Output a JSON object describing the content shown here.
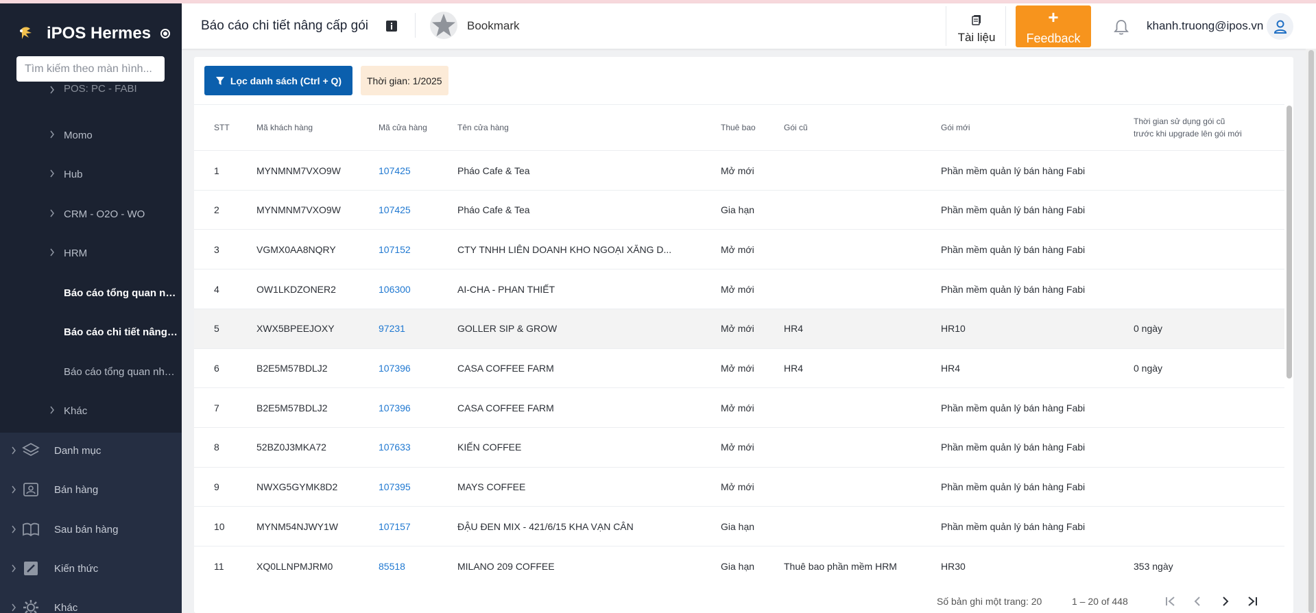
{
  "app": {
    "name": "iPOS Hermes"
  },
  "sidebar": {
    "search_placeholder": "Tìm kiếm theo màn hình...",
    "sub_items": [
      {
        "label": "POS: PC - FABI"
      },
      {
        "label": "Momo"
      },
      {
        "label": "Hub"
      },
      {
        "label": "CRM - O2O - WO"
      },
      {
        "label": "HRM"
      },
      {
        "label": "Báo cáo tổng quan nâng cấp gói"
      },
      {
        "label": "Báo cáo chi tiết nâng cấp gói"
      },
      {
        "label": "Báo cáo tổng quan nhân sự"
      },
      {
        "label": "Khác"
      }
    ],
    "main_items": [
      {
        "label": "Danh mục",
        "icon": "layers-icon"
      },
      {
        "label": "Bán hàng",
        "icon": "cashier-icon"
      },
      {
        "label": "Sau bán hàng",
        "icon": "book-icon"
      },
      {
        "label": "Kiến thức",
        "icon": "edit-box-icon"
      },
      {
        "label": "Khác",
        "icon": "gear-icon"
      }
    ]
  },
  "header": {
    "title": "Báo cáo chi tiết nâng cấp gói",
    "bookmark_label": "Bookmark",
    "docs_label": "Tài liệu",
    "feedback_plus": "+",
    "feedback_label": "Feedback",
    "user_email": "khanh.truong@ipos.vn"
  },
  "toolbar": {
    "filter_label": "Lọc danh sách (Ctrl + Q)",
    "time_label": "Thời gian: 1/2025"
  },
  "table": {
    "headers": {
      "stt": "STT",
      "customer_code": "Mã khách hàng",
      "store_code": "Mã cửa hàng",
      "store_name": "Tên cửa hàng",
      "subscription": "Thuê bao",
      "old_package": "Gói cũ",
      "new_package": "Gói mới",
      "usage_time_line1": "Thời gian sử dụng gói cũ",
      "usage_time_line2": "trước khi upgrade lên gói mới"
    },
    "rows": [
      {
        "stt": "1",
        "customer_code": "MYNMNM7VXO9W",
        "store_code": "107425",
        "store_name": "Pháo Cafe & Tea",
        "subscription": "Mở mới",
        "old_package": "",
        "new_package": "Phần mềm quản lý bán hàng Fabi",
        "usage_time": ""
      },
      {
        "stt": "2",
        "customer_code": "MYNMNM7VXO9W",
        "store_code": "107425",
        "store_name": "Pháo Cafe & Tea",
        "subscription": "Gia hạn",
        "old_package": "",
        "new_package": "Phần mềm quản lý bán hàng Fabi",
        "usage_time": ""
      },
      {
        "stt": "3",
        "customer_code": "VGMX0AA8NQRY",
        "store_code": "107152",
        "store_name": "CTY TNHH LIÊN DOANH KHO NGOẠI XĂNG D...",
        "subscription": "Mở mới",
        "old_package": "",
        "new_package": "Phần mềm quản lý bán hàng Fabi",
        "usage_time": ""
      },
      {
        "stt": "4",
        "customer_code": "OW1LKDZONER2",
        "store_code": "106300",
        "store_name": "AI-CHA - PHAN THIẾT",
        "subscription": "Mở mới",
        "old_package": "",
        "new_package": "Phần mềm quản lý bán hàng Fabi",
        "usage_time": ""
      },
      {
        "stt": "5",
        "customer_code": "XWX5BPEEJOXY",
        "store_code": "97231",
        "store_name": "GOLLER SIP & GROW",
        "subscription": "Mở mới",
        "old_package": "HR4",
        "new_package": "HR10",
        "usage_time": "0 ngày"
      },
      {
        "stt": "6",
        "customer_code": "B2E5M57BDLJ2",
        "store_code": "107396",
        "store_name": "CASA COFFEE FARM",
        "subscription": "Mở mới",
        "old_package": "HR4",
        "new_package": "HR4",
        "usage_time": "0 ngày"
      },
      {
        "stt": "7",
        "customer_code": "B2E5M57BDLJ2",
        "store_code": "107396",
        "store_name": "CASA COFFEE FARM",
        "subscription": "Mở mới",
        "old_package": "",
        "new_package": "Phần mềm quản lý bán hàng Fabi",
        "usage_time": ""
      },
      {
        "stt": "8",
        "customer_code": "52BZ0J3MKA72",
        "store_code": "107633",
        "store_name": "KIẾN COFFEE",
        "subscription": "Mở mới",
        "old_package": "",
        "new_package": "Phần mềm quản lý bán hàng Fabi",
        "usage_time": ""
      },
      {
        "stt": "9",
        "customer_code": "NWXG5GYMK8D2",
        "store_code": "107395",
        "store_name": "MAYS COFFEE",
        "subscription": "Mở mới",
        "old_package": "",
        "new_package": "Phần mềm quản lý bán hàng Fabi",
        "usage_time": ""
      },
      {
        "stt": "10",
        "customer_code": "MYNM54NJWY1W",
        "store_code": "107157",
        "store_name": "ĐẬU ĐEN MIX - 421/6/15 KHA VẠN CÂN",
        "subscription": "Gia hạn",
        "old_package": "",
        "new_package": "Phần mềm quản lý bán hàng Fabi",
        "usage_time": ""
      },
      {
        "stt": "11",
        "customer_code": "XQ0LLNPMJRM0",
        "store_code": "85518",
        "store_name": "MILANO 209 COFFEE",
        "subscription": "Gia hạn",
        "old_package": "Thuê bao phần mềm HRM",
        "new_package": "HR30",
        "usage_time": "353 ngày"
      }
    ]
  },
  "pagination": {
    "per_page_label": "Số bản ghi một trang: 20",
    "range_label": "1 – 20 of 448"
  },
  "colors": {
    "sidebar_bg": "#1b2231",
    "primary": "#0b5fad",
    "feedback": "#f7941d",
    "link": "#1f78d1",
    "time_badge_bg": "#fcebd8"
  }
}
